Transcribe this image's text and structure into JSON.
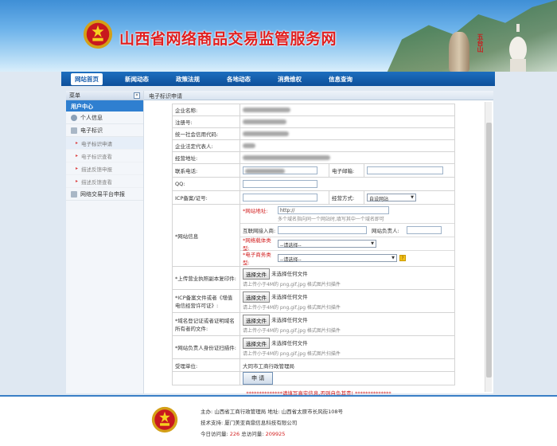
{
  "header": {
    "title": "山西省网络商品交易监管服务网",
    "scenery_text": "五台山"
  },
  "nav": [
    {
      "label": "网站首页",
      "active": true
    },
    {
      "label": "新闻动态"
    },
    {
      "label": "政策法规"
    },
    {
      "label": "各地动态"
    },
    {
      "label": "消费维权"
    },
    {
      "label": "信息查询"
    }
  ],
  "sidebar": {
    "title": "菜单",
    "collapse_icon": "«",
    "user_center": "用户中心",
    "groups": [
      {
        "label": "个人信息",
        "icon": "user-icon"
      },
      {
        "label": "电子标识",
        "icon": "tag-icon"
      }
    ],
    "subitems": [
      {
        "label": "电子标识申请",
        "active": true
      },
      {
        "label": "电子标识查看"
      },
      {
        "label": "描述反馈申报"
      },
      {
        "label": "描述反馈查看"
      }
    ],
    "trade_platform": "网络交易平台申报"
  },
  "content": {
    "title": "电子标识申请",
    "labels": {
      "company_name": "企业名称:",
      "reg_no": "注册号:",
      "credit_code": "统一社会信用代码:",
      "legal_rep": "企业法定代表人:",
      "address": "经营地址:",
      "phone": "联系电话:",
      "email": "电子邮箱:",
      "qq": "QQ:",
      "icp": "ICP备案/证号:",
      "biz_mode": "经营方式:",
      "site_info": "*网站信息",
      "site_url": "*网站地址:",
      "isp": "互联网接入商:",
      "site_owner": "网站负责人:",
      "carrier_type": "*网络载体类型:",
      "ecommerce_type": "*电子商务类型:",
      "upload_license": "*上传营业执照副本复印件:",
      "upload_icp": "*ICP备案文件或者《增值电信经营许可证》:",
      "upload_domain": "*域名登记证或者证明域名所有者的文件:",
      "upload_id": "*网站负责人身份证扫描件:",
      "agency": "受理单位:"
    },
    "values": {
      "biz_mode": "自设网站",
      "site_url": "http://",
      "site_url_hint": "多个域名指向同一个网站时,填写其中一个域名即可",
      "carrier_type": "--请选择--",
      "ecommerce_type": "--请选择--",
      "help_icon": "?",
      "file_button": "选择文件",
      "file_status": "未选择任何文件",
      "file_hint": "请上传小于4M的 png,gif,jpg 格式图片扫描件",
      "agency": "大同市工商行政管理局",
      "submit": "申 请"
    },
    "notice": "**************请填写真实信息,否则自负其责! **************"
  },
  "footer": {
    "line1": "主办: 山西省工商行政管理局  地址: 山西省太原市长风街108号",
    "line2": "技术支持: 厦门美亚商鼎信息科技有限公司",
    "today_label": "今日访问量:",
    "today_count": "226",
    "total_label": "总访问量:",
    "total_count": "209925"
  },
  "colors": {
    "accent": "#1b5fae",
    "title_red": "#e11f1f",
    "required_red": "#d21e1e"
  }
}
